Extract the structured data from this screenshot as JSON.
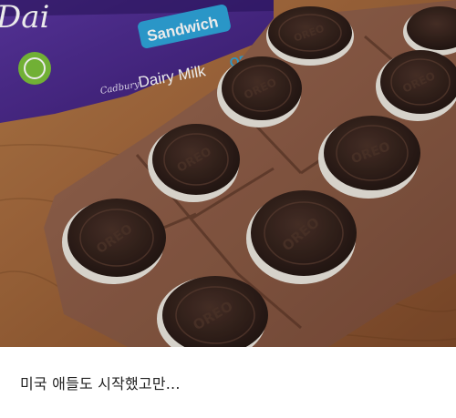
{
  "photo": {
    "subject": "Cadbury Dairy Milk chocolate bar with embedded Oreo cookies",
    "wrapper_texts": {
      "brand_partial": "Dai",
      "product_line": "Sandwich",
      "brand_full": "Dairy Milk",
      "cadbury_script": "Cadbury",
      "oreo_partial": "OR"
    },
    "cookie_stamp": "OREO",
    "colors": {
      "wrapper_purple": "#4b2a8a",
      "chocolate": "#8a5a43",
      "cookie": "#2f1f19",
      "table_wood": "#a0683c"
    }
  },
  "caption": {
    "text": "미국 애들도 시작했고만..."
  }
}
